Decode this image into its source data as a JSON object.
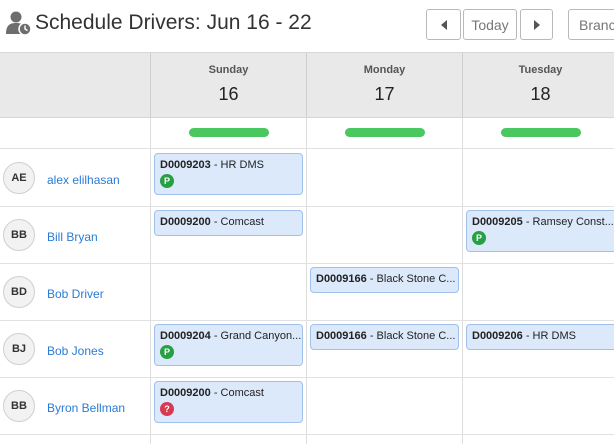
{
  "header": {
    "title": "Schedule Drivers: Jun 16 - 22",
    "prev_label": "◀",
    "today_label": "Today",
    "next_label": "▶",
    "branch_label": "Branch"
  },
  "days": [
    {
      "name": "Sunday",
      "num": "16"
    },
    {
      "name": "Monday",
      "num": "17"
    },
    {
      "name": "Tuesday",
      "num": "18"
    }
  ],
  "drivers": [
    {
      "initials": "AE",
      "name": "alex elilhasan"
    },
    {
      "initials": "BB",
      "name": "Bill Bryan"
    },
    {
      "initials": "BD",
      "name": "Bob Driver"
    },
    {
      "initials": "BJ",
      "name": "Bob Jones"
    },
    {
      "initials": "BB",
      "name": "Byron Bellman"
    }
  ],
  "events": [
    {
      "code": "D0009203",
      "text": " - HR DMS",
      "badge": "P"
    },
    {
      "code": "D0009200",
      "text": " - Comcast",
      "badge": ""
    },
    {
      "code": "D0009205",
      "text": " - Ramsey Const...",
      "badge": "P"
    },
    {
      "code": "D0009166",
      "text": " - Black Stone C...",
      "badge": ""
    },
    {
      "code": "D0009204",
      "text": " - Grand Canyon...",
      "badge": "P"
    },
    {
      "code": "D0009166",
      "text": " - Black Stone C...",
      "badge": ""
    },
    {
      "code": "D0009206",
      "text": " - HR DMS",
      "badge": ""
    },
    {
      "code": "D0009200",
      "text": " - Comcast",
      "badge": "?"
    }
  ],
  "colors": {
    "accent_link": "#2b7bd6",
    "summary_bar": "#4bc760",
    "event_bg": "#dbe9fb",
    "badge_p": "#26a043",
    "badge_q": "#d83a52"
  },
  "icons": {
    "title": "user-clock-icon",
    "prev": "triangle-left-icon",
    "next": "triangle-right-icon"
  }
}
